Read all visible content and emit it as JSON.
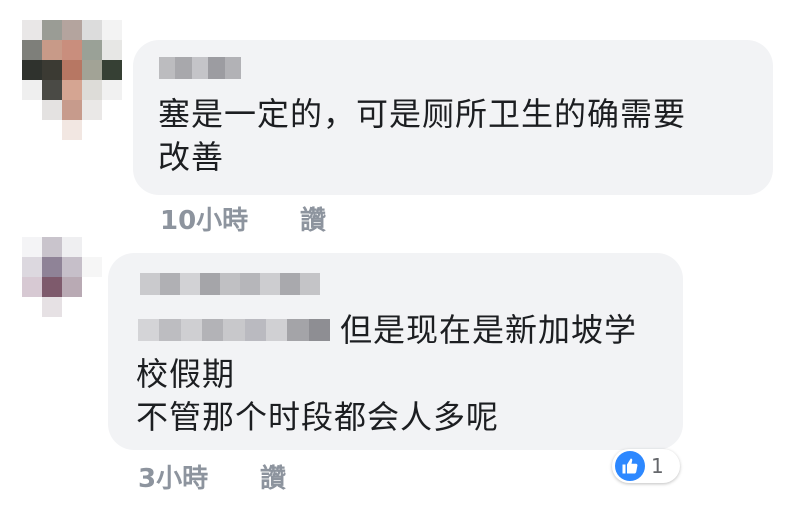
{
  "comments": [
    {
      "lines": [
        "塞是一定的，可是厕所卫生的确需要",
        "改善"
      ],
      "time": "10小時",
      "like_label": "讚"
    },
    {
      "lines": [
        "但是现在是新加坡学",
        "校假期",
        "不管那个时段都会人多呢"
      ],
      "time": "3小時",
      "like_label": "讚",
      "reaction_count": "1"
    }
  ],
  "colors": {
    "bubble": "#f2f3f5",
    "meta_text": "#8d949e",
    "like_blue": "#2d88ff"
  },
  "icons": {
    "reaction": "thumbs-up-icon"
  }
}
